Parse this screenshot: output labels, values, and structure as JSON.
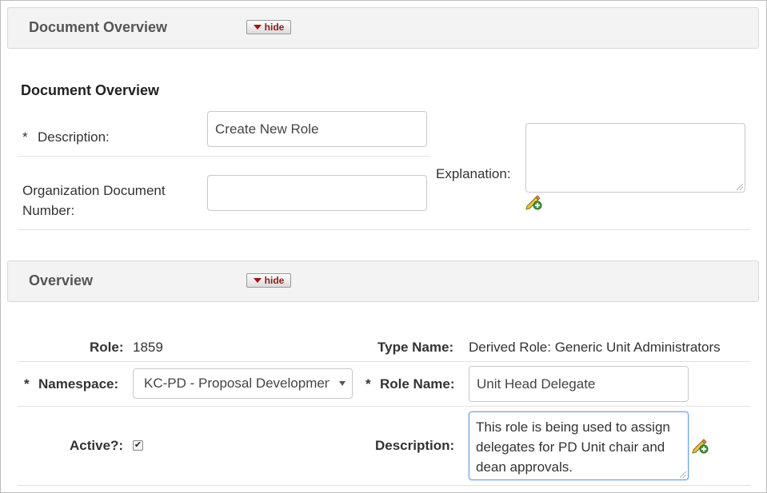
{
  "doc_overview_section": {
    "title": "Document Overview",
    "hide_label": "hide"
  },
  "doc_overview": {
    "subheading": "Document Overview",
    "description_label": "Description:",
    "required_marker": "*",
    "description_value": "Create New Role",
    "org_doc_number_label": "Organization Document Number:",
    "org_doc_number_value": "",
    "explanation_label": "Explanation:",
    "explanation_value": ""
  },
  "overview_section": {
    "title": "Overview",
    "hide_label": "hide"
  },
  "overview": {
    "role_label": "Role:",
    "role_value": "1859",
    "type_name_label": "Type Name:",
    "type_name_value": "Derived Role: Generic Unit Administrators",
    "required_marker": "*",
    "namespace_label": "Namespace:",
    "namespace_value": "KC-PD - Proposal Development",
    "role_name_label": "Role Name:",
    "role_name_value": "Unit Head Delegate",
    "active_label": "Active?:",
    "active_checked": "✔",
    "description_label": "Description:",
    "description_value": "This role is being used to assign delegates for PD Unit chair and dean approvals."
  },
  "icons": {
    "edit_icon": "pencil-add-icon",
    "caret_icon": "caret-down-icon"
  }
}
